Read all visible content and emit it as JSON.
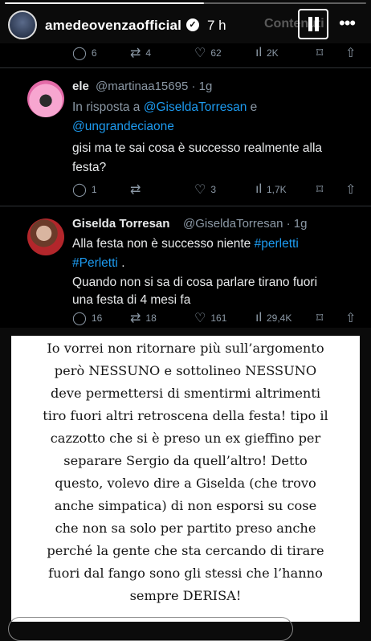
{
  "story": {
    "username": "amedeovenzaofficial",
    "time": "7 h",
    "ghost_tab": "Contenuti",
    "more": "•••",
    "progress": 0.55
  },
  "tweets": {
    "top_actions": {
      "replies": "6",
      "retweets": "4",
      "likes": "62",
      "views": "2K"
    },
    "reply1": {
      "name": "ele",
      "handle": "@martinaa15695 · 1g",
      "in_reply_prefix": "In risposta a",
      "in_reply_user1": "@GiseldaTorresan",
      "in_reply_and": "e",
      "in_reply_user2": "@ungrandeciaone",
      "text_line1": "gisi ma te sai cosa è successo realmente alla",
      "text_line2": "festa?",
      "actions": {
        "replies": "1",
        "retweets": "",
        "likes": "3",
        "views": "1,7K"
      }
    },
    "reply2": {
      "name": "Giselda Torresan",
      "handle": "@GiseldaTorresan · 1g",
      "text_line1": "Alla festa non è successo niente",
      "hashtag1": "#perletti",
      "hashtag2": "#Perletti",
      "text_line2_end": ".",
      "text_line3": "Quando non si sa di cosa parlare tirano fuori",
      "text_line4": "una festa di 4 mesi fa",
      "actions": {
        "replies": "16",
        "retweets": "18",
        "likes": "161",
        "views": "29,4K"
      }
    }
  },
  "caption": {
    "lines": [
      "Io vorrei non ritornare più sull’argomento",
      "però NESSUNO e sottolineo NESSUNO",
      "deve permettersi di smentirmi altrimenti",
      "tiro fuori altri retroscena della festa! tipo il",
      "cazzotto che si è preso un ex gieffino per",
      "separare Sergio da quell’altro! Detto",
      "questo, volevo dire a Giselda (che trovo",
      "anche simpatica) di non esporsi su cose",
      "che non sa solo per partito preso anche",
      "perché la gente che sta cercando di tirare",
      "fuori dal fango sono gli stessi che l’hanno",
      "sempre DERISA!"
    ]
  },
  "icons": {
    "reply": "💬",
    "retweet": "⇄",
    "like": "♡",
    "views": "📊",
    "bookmark": "🔖",
    "share": "⇧"
  }
}
